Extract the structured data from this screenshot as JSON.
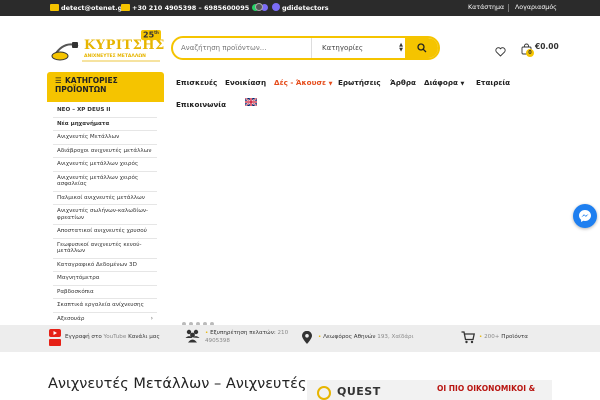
{
  "topbar": {
    "email": "detect@otenet.gr",
    "phones": "+30 210 4905398 – 6985600095",
    "social": "gdidetectors",
    "store_link": "Κατάστημα",
    "account_link": "Λογαριασμός"
  },
  "logo": {
    "title": "ΚΥΡΙΤΣΗΣ",
    "subtitle": "ΑΝΙΧΝΕΥΤΕΣ ΜΕΤΑΛΛΩΝ",
    "anniversary": "25",
    "anniversary_suffix": "th"
  },
  "search": {
    "placeholder": "Αναζήτηση προϊόντων...",
    "category_label": "Κατηγορίες"
  },
  "cart": {
    "count": "0",
    "total": "€0.00"
  },
  "categories": {
    "header": "ΚΑΤΗΓΟΡΙΕΣ ΠΡΟΪΟΝΤΩΝ",
    "items": [
      "ΝΕΟ – XP DEUS II",
      "Νέα μηχανήματα",
      "Ανιχνευτές Μετάλλων",
      "Αδιάβροχοι ανιχνευτές μετάλλων",
      "Ανιχνευτές μετάλλων χειρός",
      "Ανιχνευτές μετάλλων χειρός ασφαλείας",
      "Παλμικοί ανιχνευτές μετάλλων",
      "Ανιχνευτές σωλήνων-καλωδίων-φρεατίων",
      "Αποστατικοί ανιχνευτές χρυσού",
      "Γεωφυσικοί ανιχνευτές κενού-μετάλλων",
      "Καταγραφικό Δεδομένων 3D",
      "Μαγνητόμετρα",
      "Ραβδοσκόπια",
      "Σκαπτικά εργαλεία ανίχνευσης",
      "Αξεσουάρ"
    ]
  },
  "nav": {
    "items": [
      {
        "label": "Επισκευές"
      },
      {
        "label": "Ενοικίαση"
      },
      {
        "label": "Δές - Άκουσε"
      },
      {
        "label": "Ερωτήσεις"
      },
      {
        "label": "Άρθρα"
      },
      {
        "label": "Διάφορα"
      },
      {
        "label": "Εταιρεία"
      },
      {
        "label": "Επικοινωνία"
      }
    ]
  },
  "features": {
    "youtube_pre": "Εγγραφή στο",
    "youtube_brand": "YouTube",
    "youtube_post": "Κανάλι μας",
    "support_label": "Εξυπηρέτηση πελατών:",
    "support_phone": "210",
    "support_phone2": "4905398",
    "address_label": "Λεωφόρος Αθηνών",
    "address_value": "193, Χαϊδάρι",
    "products_count": "200+",
    "products_label": "Προϊόντα"
  },
  "page": {
    "heading": "Ανιχνευτές Μετάλλων – Ανιχνευτές"
  },
  "banner": {
    "brand": "QUEST",
    "text": "ΟΙ ΠΙΟ ΟΙΚΟΝΟΜΙΚΟΙ &"
  },
  "colors": {
    "accent": "#f5c400",
    "topbar_bg": "#2b2b2b",
    "nav_highlight": "#e54c1b",
    "messenger": "#1e7ff0"
  }
}
